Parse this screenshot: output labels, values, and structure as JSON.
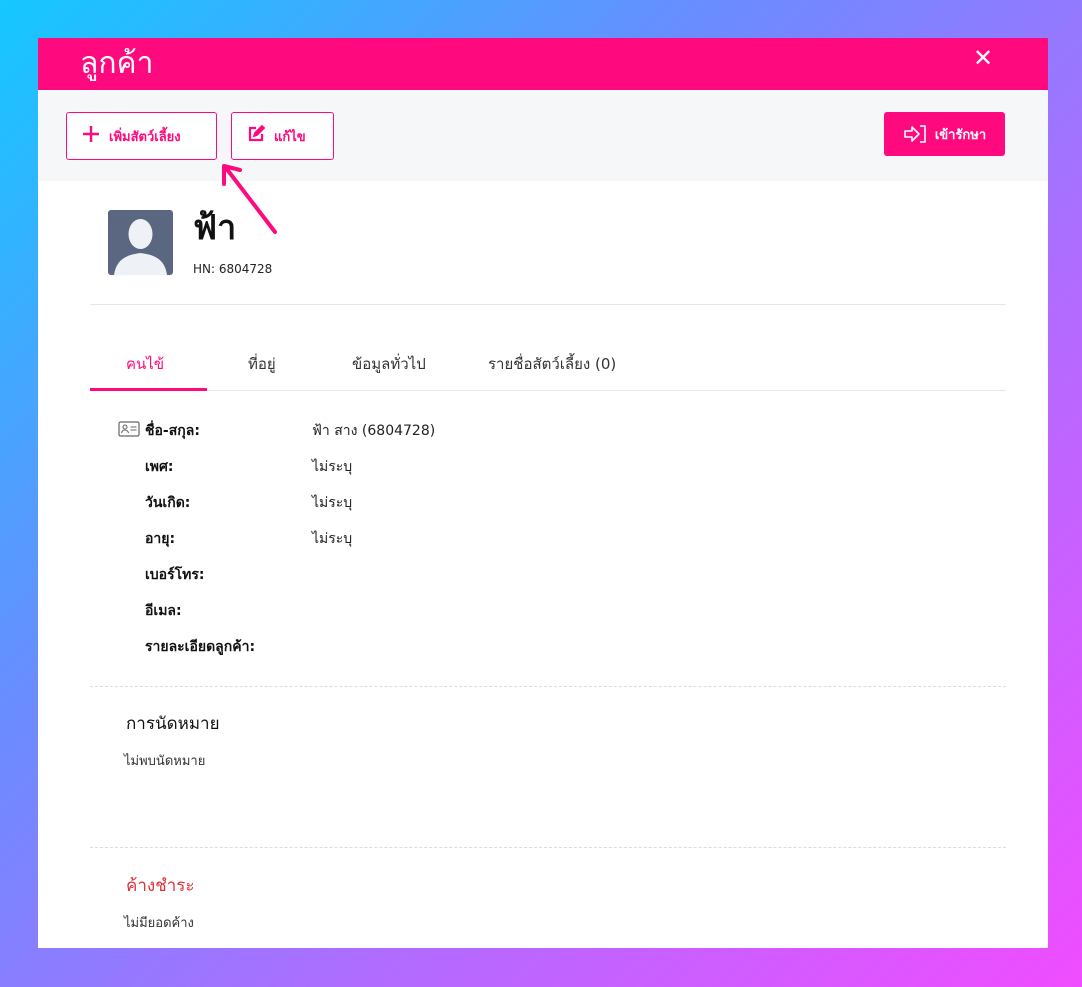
{
  "modal": {
    "title": "ลูกค้า",
    "close_label": "✕"
  },
  "toolbar": {
    "add_pet_label": "เพิ่มสัตว์เลี้ยง",
    "edit_label": "แก้ไข",
    "admit_label": "เข้ารักษา"
  },
  "profile": {
    "name": "ฟ้า",
    "hn": "HN: 6804728"
  },
  "tabs": [
    {
      "label": "คนไข้",
      "active": true
    },
    {
      "label": "ที่อยู่",
      "active": false
    },
    {
      "label": "ข้อมูลทั่วไป",
      "active": false
    },
    {
      "label": "รายชื่อสัตว์เลี้ยง (0)",
      "active": false
    }
  ],
  "info": {
    "rows": [
      {
        "label": "ชื่อ-สกุล:",
        "value": "ฟ้า สาง (6804728)"
      },
      {
        "label": "เพศ:",
        "value": "ไม่ระบุ"
      },
      {
        "label": "วันเกิด:",
        "value": "ไม่ระบุ"
      },
      {
        "label": "อายุ:",
        "value": "ไม่ระบุ"
      },
      {
        "label": "เบอร์โทร:",
        "value": ""
      },
      {
        "label": "อีเมล:",
        "value": ""
      },
      {
        "label": "รายละเอียดลูกค้า:",
        "value": ""
      }
    ]
  },
  "appointments": {
    "title": "การนัดหมาย",
    "text": "ไม่พบนัดหมาย"
  },
  "outstanding": {
    "title": "ค้างชำระ",
    "text": "ไม่มียอดค้าง"
  },
  "colors": {
    "accent": "#ff0a7e",
    "danger": "#e0303a"
  }
}
